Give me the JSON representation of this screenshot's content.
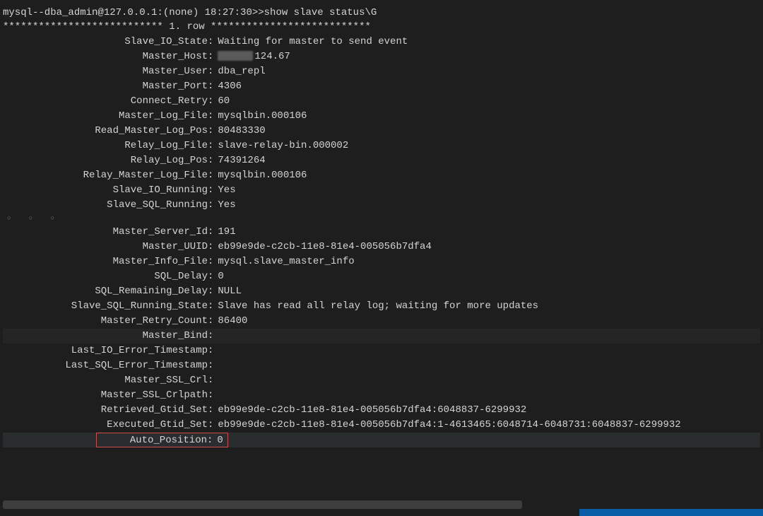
{
  "prompt": "mysql--dba_admin@127.0.0.1:(none) 18:27:30>>show slave status\\G",
  "row_header": "*************************** 1. row ***************************",
  "dots": "○  ○  ○",
  "fields": {
    "slave_io_state": {
      "k": "Slave_IO_State",
      "v": "Waiting for master to send event"
    },
    "master_host": {
      "k": "Master_Host",
      "v": "124.67",
      "redacted_prefix": true
    },
    "master_user": {
      "k": "Master_User",
      "v": "dba_repl"
    },
    "master_port": {
      "k": "Master_Port",
      "v": "4306"
    },
    "connect_retry": {
      "k": "Connect_Retry",
      "v": "60"
    },
    "master_log_file": {
      "k": "Master_Log_File",
      "v": "mysqlbin.000106"
    },
    "read_master_log_pos": {
      "k": "Read_Master_Log_Pos",
      "v": "80483330"
    },
    "relay_log_file": {
      "k": "Relay_Log_File",
      "v": "slave-relay-bin.000002"
    },
    "relay_log_pos": {
      "k": "Relay_Log_Pos",
      "v": "74391264"
    },
    "relay_master_log_file": {
      "k": "Relay_Master_Log_File",
      "v": "mysqlbin.000106"
    },
    "slave_io_running": {
      "k": "Slave_IO_Running",
      "v": "Yes"
    },
    "slave_sql_running": {
      "k": "Slave_SQL_Running",
      "v": "Yes"
    },
    "master_server_id": {
      "k": "Master_Server_Id",
      "v": "191"
    },
    "master_uuid": {
      "k": "Master_UUID",
      "v": "eb99e9de-c2cb-11e8-81e4-005056b7dfa4"
    },
    "master_info_file": {
      "k": "Master_Info_File",
      "v": "mysql.slave_master_info"
    },
    "sql_delay": {
      "k": "SQL_Delay",
      "v": "0"
    },
    "sql_remaining_delay": {
      "k": "SQL_Remaining_Delay",
      "v": "NULL"
    },
    "slave_sql_running_state": {
      "k": "Slave_SQL_Running_State",
      "v": "Slave has read all relay log; waiting for more updates"
    },
    "master_retry_count": {
      "k": "Master_Retry_Count",
      "v": "86400"
    },
    "master_bind": {
      "k": "Master_Bind",
      "v": ""
    },
    "last_io_err_ts": {
      "k": "Last_IO_Error_Timestamp",
      "v": ""
    },
    "last_sql_err_ts": {
      "k": "Last_SQL_Error_Timestamp",
      "v": ""
    },
    "master_ssl_crl": {
      "k": "Master_SSL_Crl",
      "v": ""
    },
    "master_ssl_crlpath": {
      "k": "Master_SSL_Crlpath",
      "v": ""
    },
    "retrieved_gtid_set": {
      "k": "Retrieved_Gtid_Set",
      "v": "eb99e9de-c2cb-11e8-81e4-005056b7dfa4:6048837-6299932"
    },
    "executed_gtid_set": {
      "k": "Executed_Gtid_Set",
      "v": "eb99e9de-c2cb-11e8-81e4-005056b7dfa4:1-4613465:6048714-6048731:6048837-6299932"
    },
    "auto_position": {
      "k": "Auto_Position",
      "v": "0"
    }
  }
}
